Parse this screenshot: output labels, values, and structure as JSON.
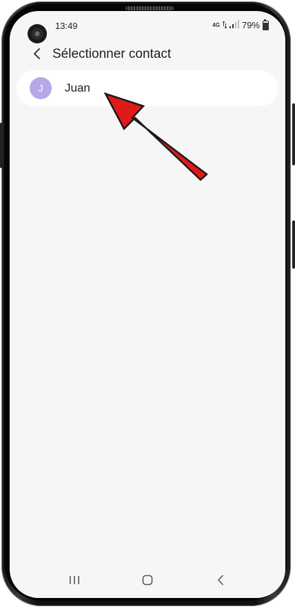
{
  "status_bar": {
    "time": "13:49",
    "network": "4G",
    "battery_percent": "79%",
    "battery_level": 0.79
  },
  "header": {
    "title": "Sélectionner contact"
  },
  "contacts": [
    {
      "initial": "J",
      "name": "Juan",
      "avatar_color": "#b5a8e6"
    }
  ],
  "colors": {
    "screen_bg": "#f6f6f6",
    "arrow": "#e01a1a"
  },
  "icons": {
    "back": "chevron-left-icon",
    "recent_apps": "recent-apps-icon",
    "home": "home-icon",
    "nav_back": "back-icon"
  }
}
